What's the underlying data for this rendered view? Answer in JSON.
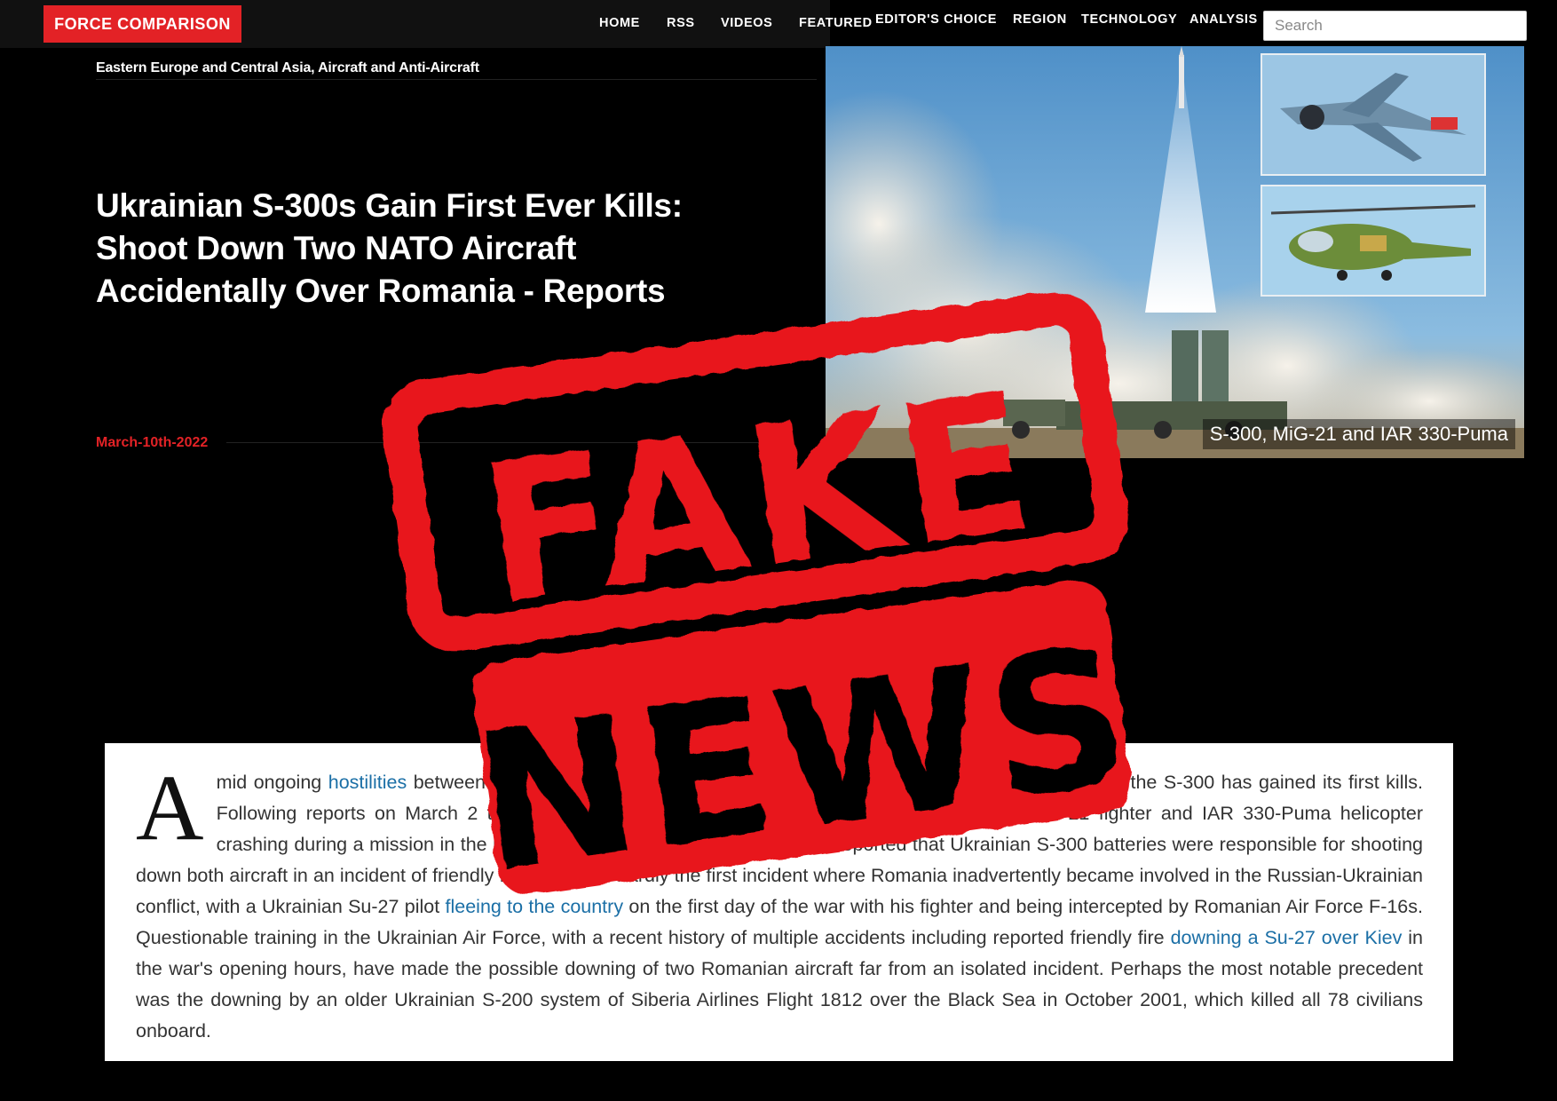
{
  "site": {
    "logo": "FORCE COMPARISON",
    "nav": [
      "HOME",
      "RSS",
      "VIDEOS",
      "FEATURED",
      "EDITOR'S CHOICE",
      "REGION",
      "TECHNOLOGY",
      "ANALYSIS"
    ],
    "search_placeholder": "Search"
  },
  "article": {
    "categories": "Eastern Europe and Central Asia, Aircraft and Anti-Aircraft",
    "headline_lines": [
      "Ukrainian S-300s Gain First Ever Kills:",
      "Shoot Down Two NATO Aircraft",
      "Accidentally Over Romania - Reports"
    ],
    "date": "March-10th-2022",
    "image_caption": "S-300, MiG-21 and IAR 330-Puma",
    "dropcap": "A",
    "body": {
      "s1": "mid ongoing ",
      "link1": "hostilities",
      "s2": " between Russian and Ukrainian forces, the latter's most potent air defence system the S-300 has gained its first kills. Following reports on March 2 that eight Romanian military personnel had died following a MiG-21 fighter and IAR 330-Puma helicopter crashing during a mission in the proximity of the Ukrainian border, it was reported that Ukrainian S-300 batteries were responsible for shooting down both aircraft in an incident of friendly fire. This was hardly the first incident where Romania inadvertently became involved in the Russian-Ukrainian conflict, with a Ukrainian Su-27 pilot ",
      "link2": "fleeing to the country",
      "s3": " on the first day of the war with his fighter and being intercepted by Romanian Air Force F-16s. Questionable training in the Ukrainian Air Force, with a recent history of multiple accidents including reported friendly fire ",
      "link3": "downing a Su-27 over Kiev",
      "s4": " in the war's opening hours, have made the possible downing of two Romanian aircraft far from an isolated incident. Perhaps the most notable precedent was the downing by an older Ukrainian S-200 system of Siberia Airlines Flight 1812 over the Black Sea in October 2001, which killed all 78 civilians onboard."
    }
  },
  "stamp": {
    "line1": "FAKE",
    "line2": "NEWS",
    "color": "#e8131f"
  },
  "colors": {
    "brand_red": "#e32226",
    "link_blue": "#1b6fa6"
  }
}
